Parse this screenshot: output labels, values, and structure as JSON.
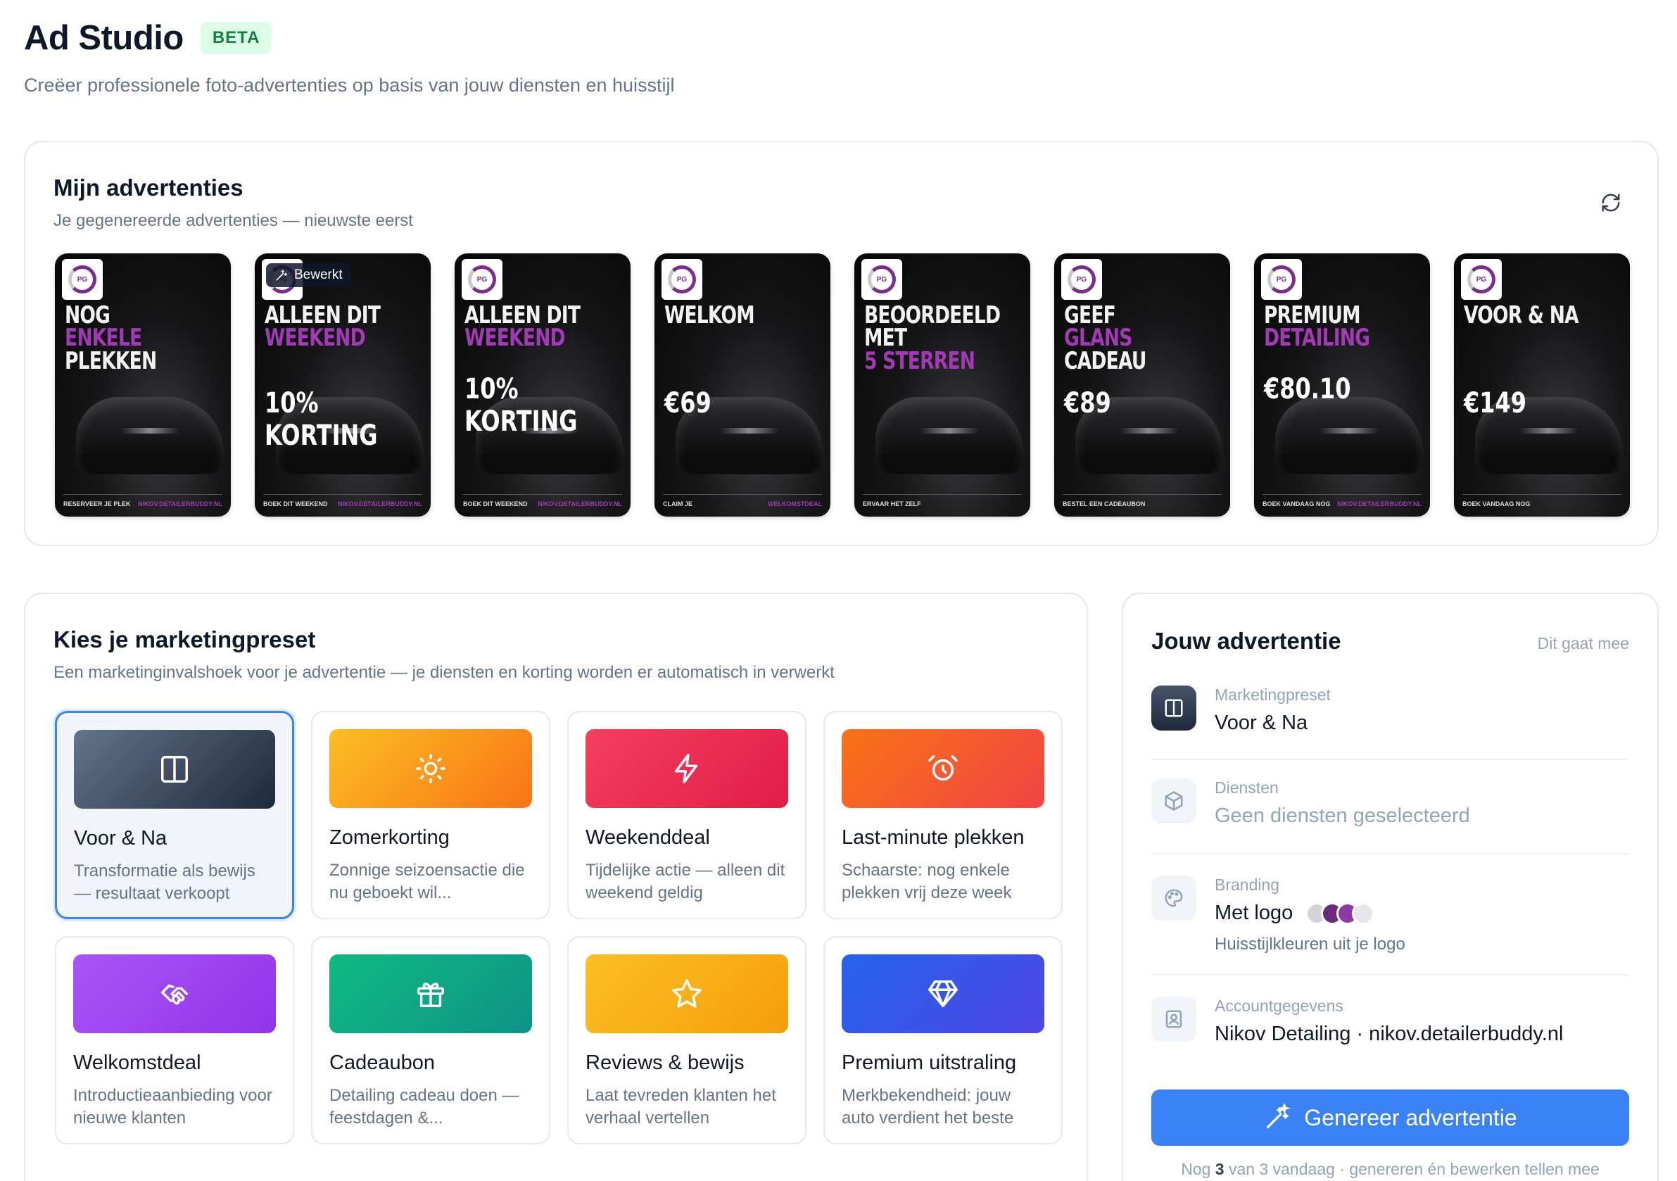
{
  "header": {
    "title": "Ad Studio",
    "badge": "BETA",
    "subtitle": "Creëer professionele foto-advertenties op basis van jouw diensten en huisstijl"
  },
  "ads": {
    "title": "Mijn advertenties",
    "subtitle": "Je gegenereerde advertenties — nieuwste eerst",
    "refresh_icon": "refresh-icon",
    "items": [
      {
        "line1": "NOG",
        "line2": "ENKELE",
        "line3": "PLEKKEN",
        "price": "",
        "footer": "RESERVEER JE PLEK",
        "site": "NIKOV.DETAILERBUDDY.NL",
        "badge": ""
      },
      {
        "line1": "ALLEEN DIT",
        "line2": "WEEKEND",
        "line3": "",
        "price": "10% KORTING",
        "footer": "BOEK DIT WEEKEND",
        "site": "NIKOV.DETAILERBUDDY.NL",
        "badge": "Bewerkt"
      },
      {
        "line1": "ALLEEN DIT",
        "line2": "WEEKEND",
        "line3": "",
        "price": "10% KORTING",
        "footer": "BOEK DIT WEEKEND",
        "site": "NIKOV.DETAILERBUDDY.NL",
        "badge": ""
      },
      {
        "line1": "WELKOM",
        "line2": "",
        "line3": "",
        "price": "€69",
        "footer": "CLAIM JE",
        "site": "WELKOMSTDEAL",
        "badge": ""
      },
      {
        "line1": "BEOORDEELD MET",
        "line2": "5 STERREN",
        "line3": "",
        "price": "",
        "footer": "ERVAAR HET ZELF",
        "site": "",
        "badge": ""
      },
      {
        "line1": "GEEF",
        "line2": "GLANS",
        "line3": "CADEAU",
        "price": "€89",
        "footer": "BESTEL EEN CADEAUBON",
        "site": "",
        "badge": ""
      },
      {
        "line1": "PREMIUM",
        "line2": "DETAILING",
        "line3": "",
        "price": "€80.10",
        "footer": "BOEK VANDAAG NOG",
        "site": "NIKOV.DETAILERBUDDY.NL",
        "badge": ""
      },
      {
        "line1": "VOOR & NA",
        "line2": "",
        "line3": "",
        "price": "€149",
        "footer": "BOEK VANDAAG NOG",
        "site": "",
        "badge": ""
      }
    ]
  },
  "presets": {
    "title": "Kies je marketingpreset",
    "subtitle": "Een marketinginvalshoek voor je advertentie — je diensten en korting worden er automatisch in verwerkt",
    "items": [
      {
        "name": "Voor & Na",
        "desc": "Transformatie als bewijs — resultaat verkoopt",
        "icon": "split-view-icon",
        "c1": "#64748b",
        "c2": "#1e293b",
        "selected": true
      },
      {
        "name": "Zomerkorting",
        "desc": "Zonnige seizoensactie die nu geboekt wil...",
        "icon": "sun-icon",
        "c1": "#fbbf24",
        "c2": "#f97316",
        "selected": false
      },
      {
        "name": "Weekenddeal",
        "desc": "Tijdelijke actie — alleen dit weekend geldig",
        "icon": "lightning-icon",
        "c1": "#f43f5e",
        "c2": "#e11d48",
        "selected": false
      },
      {
        "name": "Last-minute plekken",
        "desc": "Schaarste: nog enkele plekken vrij deze week",
        "icon": "alarm-clock-icon",
        "c1": "#f97316",
        "c2": "#ef4444",
        "selected": false
      },
      {
        "name": "Welkomstdeal",
        "desc": "Introductieaanbieding voor nieuwe klanten",
        "icon": "handshake-icon",
        "c1": "#a855f7",
        "c2": "#9333ea",
        "selected": false
      },
      {
        "name": "Cadeaubon",
        "desc": "Detailing cadeau doen — feestdagen &...",
        "icon": "gift-icon",
        "c1": "#10b981",
        "c2": "#0d9488",
        "selected": false
      },
      {
        "name": "Reviews & bewijs",
        "desc": "Laat tevreden klanten het verhaal vertellen",
        "icon": "star-icon",
        "c1": "#fbbf24",
        "c2": "#f59e0b",
        "selected": false
      },
      {
        "name": "Premium uitstraling",
        "desc": "Merkbekendheid: jouw auto verdient het beste",
        "icon": "diamond-icon",
        "c1": "#2563eb",
        "c2": "#4f46e5",
        "selected": false
      }
    ]
  },
  "summary": {
    "title": "Jouw advertentie",
    "hint": "Dit gaat mee",
    "preset_label": "Marketingpreset",
    "preset_value": "Voor & Na",
    "services_label": "Diensten",
    "services_value": "Geen diensten geselecteerd",
    "branding_label": "Branding",
    "branding_value": "Met logo",
    "branding_sub": "Huisstijlkleuren uit je logo",
    "brand_colors": [
      "#d4d4d8",
      "#6b2a7a",
      "#8e3aa0",
      "#e5e7eb"
    ],
    "account_label": "Accountgegevens",
    "account_value": "Nikov Detailing · nikov.detailerbuddy.nl",
    "generate_label": "Genereer advertentie",
    "quota_prefix": "Nog",
    "quota_count": "3",
    "quota_suffix": "van 3 vandaag · genereren én bewerken tellen mee"
  }
}
